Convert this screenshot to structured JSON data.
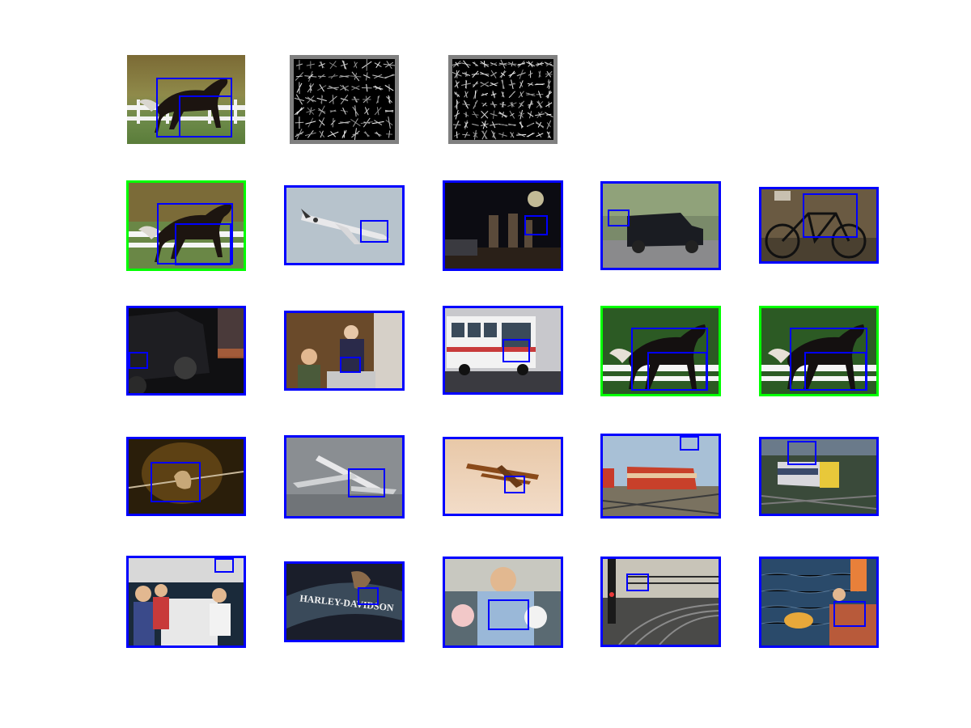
{
  "colors": {
    "detection_box": "#0000ff",
    "positive_frame": "#00ff00",
    "template_border": "#808080"
  },
  "grid": {
    "rows": 5,
    "cols": 5
  },
  "panels": [
    {
      "row": 0,
      "col": 0,
      "kind": "query-photo",
      "scene": "horse",
      "frame": "none"
    },
    {
      "row": 0,
      "col": 1,
      "kind": "hog-template",
      "frame": "gray"
    },
    {
      "row": 0,
      "col": 2,
      "kind": "hog-template",
      "frame": "gray"
    },
    {
      "row": 1,
      "col": 0,
      "kind": "detection",
      "scene": "horse",
      "frame": "green"
    },
    {
      "row": 1,
      "col": 1,
      "kind": "detection",
      "scene": "aeroplane",
      "frame": "blue"
    },
    {
      "row": 1,
      "col": 2,
      "kind": "detection",
      "scene": "concert",
      "frame": "blue"
    },
    {
      "row": 1,
      "col": 3,
      "kind": "detection",
      "scene": "car",
      "frame": "blue"
    },
    {
      "row": 1,
      "col": 4,
      "kind": "detection",
      "scene": "bicycle",
      "frame": "blue"
    },
    {
      "row": 2,
      "col": 0,
      "kind": "detection",
      "scene": "dark-car",
      "frame": "blue"
    },
    {
      "row": 2,
      "col": 1,
      "kind": "detection",
      "scene": "children",
      "frame": "blue"
    },
    {
      "row": 2,
      "col": 2,
      "kind": "detection",
      "scene": "bus",
      "frame": "blue"
    },
    {
      "row": 2,
      "col": 3,
      "kind": "detection",
      "scene": "horse",
      "frame": "green"
    },
    {
      "row": 2,
      "col": 4,
      "kind": "detection",
      "scene": "horse",
      "frame": "green"
    },
    {
      "row": 3,
      "col": 0,
      "kind": "detection",
      "scene": "bird",
      "frame": "blue"
    },
    {
      "row": 3,
      "col": 1,
      "kind": "detection",
      "scene": "jet",
      "frame": "blue"
    },
    {
      "row": 3,
      "col": 2,
      "kind": "detection",
      "scene": "biplane",
      "frame": "blue"
    },
    {
      "row": 3,
      "col": 3,
      "kind": "detection",
      "scene": "train",
      "frame": "blue"
    },
    {
      "row": 3,
      "col": 4,
      "kind": "detection",
      "scene": "train",
      "frame": "blue"
    },
    {
      "row": 4,
      "col": 0,
      "kind": "detection",
      "scene": "party",
      "frame": "blue"
    },
    {
      "row": 4,
      "col": 1,
      "kind": "detection",
      "scene": "motorbike",
      "frame": "blue"
    },
    {
      "row": 4,
      "col": 2,
      "kind": "detection",
      "scene": "man-baby-dog",
      "frame": "blue"
    },
    {
      "row": 4,
      "col": 3,
      "kind": "detection",
      "scene": "railway",
      "frame": "blue"
    },
    {
      "row": 4,
      "col": 4,
      "kind": "detection",
      "scene": "water",
      "frame": "blue"
    }
  ],
  "text": {
    "motorbike_sign": "HARLEY-DAVIDSON"
  }
}
